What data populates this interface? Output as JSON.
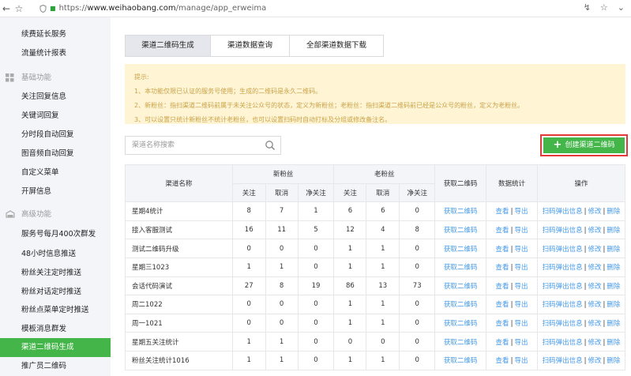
{
  "browser": {
    "url_scheme": "https://",
    "url_host": "www.weihaobang.com",
    "url_path": "/manage/app_erweima"
  },
  "sidebar": {
    "items_top": [
      {
        "label": "续费延长服务"
      },
      {
        "label": "流量统计报表"
      }
    ],
    "group_basic": {
      "label": "基础功能",
      "icon": "grid-icon"
    },
    "items_basic": [
      {
        "label": "关注回复信息"
      },
      {
        "label": "关键词回复"
      },
      {
        "label": "分时段自动回复"
      },
      {
        "label": "图音频自动回复"
      },
      {
        "label": "自定义菜单"
      },
      {
        "label": "开屏信息"
      }
    ],
    "group_advanced": {
      "label": "高级功能",
      "icon": "cloud-icon"
    },
    "items_advanced": [
      {
        "label": "服务号每月400次群发"
      },
      {
        "label": "48小时信息推送"
      },
      {
        "label": "粉丝关注定时推送"
      },
      {
        "label": "粉丝对话定时推送"
      },
      {
        "label": "粉丝点菜单定时推送"
      },
      {
        "label": "模板消息群发"
      },
      {
        "label": "渠道二维码生成",
        "active": true
      },
      {
        "label": "推广员二维码"
      }
    ],
    "active_color": "#44b549"
  },
  "tabs": [
    {
      "label": "渠道二维码生成",
      "active": true
    },
    {
      "label": "渠道数据查询"
    },
    {
      "label": "全部渠道数据下载"
    }
  ],
  "notice": {
    "title": "提示:",
    "lines": [
      "1、本功能仅限已认证的服务号使用；生成的二维码是永久二维码。",
      "2、新粉丝：指扫渠道二维码前属于未关注公众号的状态，定义为新粉丝；老粉丝：指扫渠道二维码前已经是公众号的粉丝，定义为老粉丝。",
      "3、可以设置只统计新粉丝不统计老粉丝，也可以设置扫码时自动打标及分组或修改备注名。"
    ]
  },
  "search": {
    "placeholder": "渠道名称搜索",
    "value": "",
    "icon": "search-icon"
  },
  "create_button": {
    "label": "创建渠道二维码",
    "icon": "plus-icon"
  },
  "table": {
    "headers": {
      "channel_name": "渠道名称",
      "new_fans": "新粉丝",
      "old_fans": "老粉丝",
      "get_qr": "获取二维码",
      "stats": "数据统计",
      "actions": "操作",
      "follow": "关注",
      "cancel": "取消",
      "net": "净关注"
    },
    "link_get_qr": "获取二维码",
    "link_view": "查看",
    "link_export": "导出",
    "link_popup": "扫码弹出信息",
    "link_edit": "修改",
    "link_delete": "删除",
    "separator": "|",
    "rows": [
      {
        "name": "星期4统计",
        "nf": 8,
        "nc": 7,
        "nn": 1,
        "of": 6,
        "oc": 6,
        "on": 0
      },
      {
        "name": "接入客服测试",
        "nf": 16,
        "nc": 11,
        "nn": 5,
        "of": 12,
        "oc": 4,
        "on": 8
      },
      {
        "name": "测试二维码升级",
        "nf": 0,
        "nc": 0,
        "nn": 0,
        "of": 1,
        "oc": 1,
        "on": 0
      },
      {
        "name": "星期三1023",
        "nf": 1,
        "nc": 1,
        "nn": 0,
        "of": 1,
        "oc": 1,
        "on": 0
      },
      {
        "name": "会话代码演试",
        "nf": 27,
        "nc": 8,
        "nn": 19,
        "of": 86,
        "oc": 13,
        "on": 73
      },
      {
        "name": "周二1022",
        "nf": 0,
        "nc": 0,
        "nn": 0,
        "of": 1,
        "oc": 1,
        "on": 0
      },
      {
        "name": "周一1021",
        "nf": 0,
        "nc": 0,
        "nn": 0,
        "of": 1,
        "oc": 1,
        "on": 0
      },
      {
        "name": "星期五关注统计",
        "nf": 1,
        "nc": 1,
        "nn": 0,
        "of": 0,
        "oc": 0,
        "on": 0
      },
      {
        "name": "粉丝关注统计1016",
        "nf": 1,
        "nc": 1,
        "nn": 0,
        "of": 1,
        "oc": 1,
        "on": 0
      }
    ]
  }
}
